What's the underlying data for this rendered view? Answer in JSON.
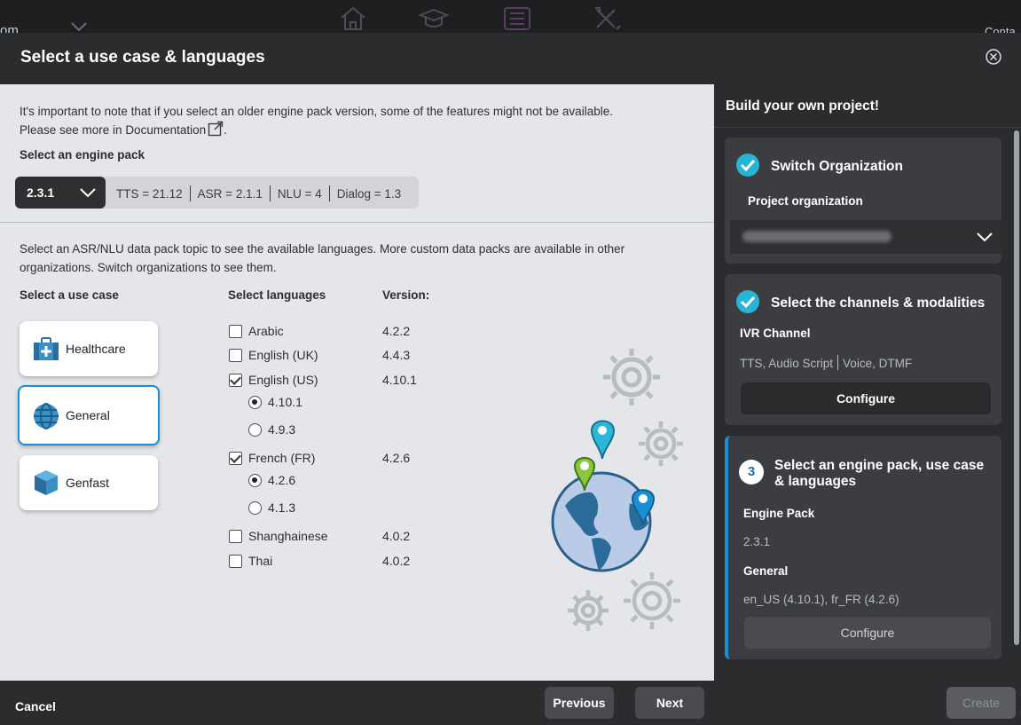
{
  "background": {
    "left_fragment": "om",
    "right_fragment": "Conta",
    "icons": [
      "home-icon",
      "graduation-cap-icon",
      "list-icon",
      "tools-icon"
    ]
  },
  "modal": {
    "title": "Select a use case & languages"
  },
  "content": {
    "notice_line1": "It's important to note that if you select an older engine pack version, some of the features might not be available.",
    "notice_line2_prefix": "Please see more in ",
    "doc_link": "Documentation",
    "notice_line2_suffix": ".",
    "engine_pack_label": "Select an engine pack",
    "engine_pack": {
      "selected": "2.3.1",
      "info": [
        "TTS = 21.12",
        "ASR = 2.1.1",
        "NLU = 4",
        "Dialog = 1.3"
      ]
    },
    "datapack_notice_line1": "Select an ASR/NLU data pack topic to see the available languages. More custom data packs are available in other",
    "datapack_notice_line2": "organizations. Switch organizations to see them.",
    "use_case_label": "Select a use case",
    "languages_label": "Select languages",
    "version_label": "Version:",
    "use_cases": [
      {
        "label": "Healthcare",
        "icon": "medical-kit-icon",
        "selected": false
      },
      {
        "label": "General",
        "icon": "globe-icon",
        "selected": true
      },
      {
        "label": "Genfast",
        "icon": "cube-icon",
        "selected": false
      }
    ],
    "languages": [
      {
        "label": "Arabic",
        "version": "4.2.2",
        "checked": false
      },
      {
        "label": "English (UK)",
        "version": "4.4.3",
        "checked": false
      },
      {
        "label": "English (US)",
        "version": "4.10.1",
        "checked": true
      },
      {
        "label": "French (FR)",
        "version": "4.2.6",
        "checked": true
      },
      {
        "label": "Shanghainese",
        "version": "4.0.2",
        "checked": false
      },
      {
        "label": "Thai",
        "version": "4.0.2",
        "checked": false
      }
    ],
    "en_us_versions": [
      {
        "label": "4.10.1",
        "selected": true
      },
      {
        "label": "4.9.3",
        "selected": false
      }
    ],
    "fr_fr_versions": [
      {
        "label": "4.2.6",
        "selected": true
      },
      {
        "label": "4.1.3",
        "selected": false
      }
    ]
  },
  "side": {
    "title": "Build your own project!",
    "step1": {
      "title": "Switch Organization",
      "sub": "Project organization"
    },
    "step2": {
      "title": "Select the channels & modalities",
      "sub": "IVR Channel",
      "value_a": "TTS, Audio Script",
      "value_b": "Voice, DTMF",
      "button": "Configure"
    },
    "step3": {
      "number": "3",
      "title_line1": "Select an engine pack, use case",
      "title_line2": "& languages",
      "engine_label": "Engine Pack",
      "engine_value": "2.3.1",
      "usecase_label": "General",
      "usecase_value": "en_US (4.10.1), fr_FR (4.2.6)",
      "button": "Configure"
    }
  },
  "footer": {
    "cancel": "Cancel",
    "previous": "Previous",
    "next": "Next",
    "create": "Create"
  },
  "colors": {
    "accent": "#1a8fd6",
    "check": "#27b5d6",
    "dark": "#2b2c2e",
    "content_bg": "#e4e6ea"
  }
}
